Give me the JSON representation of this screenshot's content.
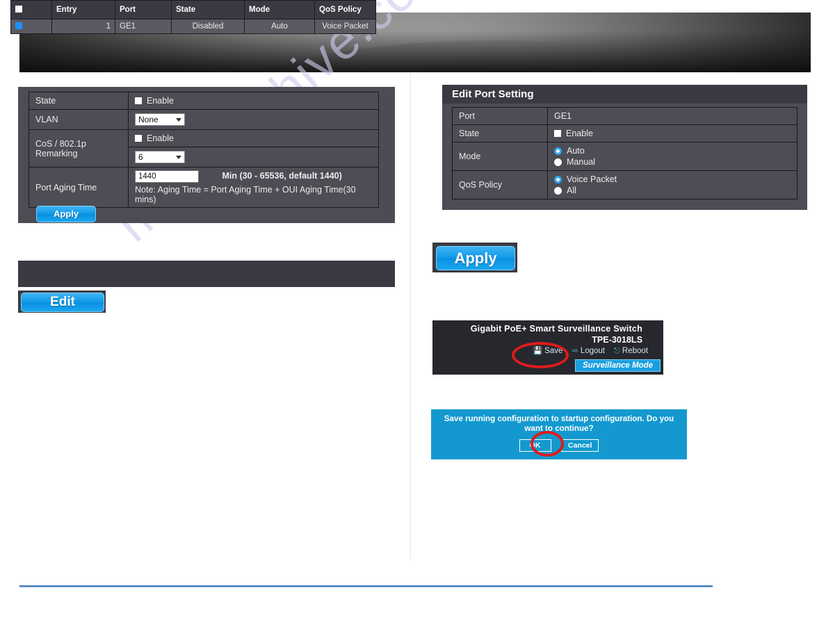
{
  "watermark": {
    "text": "manualshive.com"
  },
  "left_panel": {
    "rows": [
      {
        "label": "State",
        "control": "checkbox",
        "checkbox_label": "Enable",
        "checked": false
      },
      {
        "label": "VLAN",
        "control": "select",
        "value": "None"
      },
      {
        "label": "CoS / 802.1p Remarking",
        "label_line1": "CoS / 802.1p",
        "label_line2": "Remarking",
        "checkbox_label": "Enable",
        "checked": false,
        "select_value": "6"
      },
      {
        "label": "Port Aging Time",
        "input_value": "1440",
        "hint": "Min (30 - 65536, default 1440)",
        "note": "Note: Aging Time = Port Aging Time + OUI Aging Time(30 mins)"
      }
    ],
    "apply_label": "Apply"
  },
  "list_table": {
    "headers": [
      "",
      "Entry",
      "Port",
      "State",
      "Mode",
      "QoS Policy"
    ],
    "header_checkbox_checked": false,
    "rows": [
      {
        "checked": true,
        "entry": "1",
        "port": "GE1",
        "state": "Disabled",
        "mode": "Auto",
        "qos_policy": "Voice Packet"
      }
    ],
    "edit_label": "Edit"
  },
  "edit_port_setting": {
    "title": "Edit Port Setting",
    "port_label": "Port",
    "port_value": "GE1",
    "state_label": "State",
    "state_checkbox_label": "Enable",
    "state_checked": false,
    "mode_label": "Mode",
    "mode_options": [
      {
        "label": "Auto",
        "selected": true
      },
      {
        "label": "Manual",
        "selected": false
      }
    ],
    "qos_label": "QoS Policy",
    "qos_options": [
      {
        "label": "Voice Packet",
        "selected": true
      },
      {
        "label": "All",
        "selected": false
      }
    ],
    "apply_label": "Apply"
  },
  "device_header": {
    "product_name": "Gigabit PoE+ Smart Surveillance Switch",
    "model": "TPE-3018LS",
    "save_label": "Save",
    "logout_label": "Logout",
    "reboot_label": "Reboot",
    "mode_badge": "Surveillance Mode"
  },
  "confirm_dialog": {
    "message": "Save running configuration to startup configuration. Do you want to continue?",
    "ok_label": "OK",
    "cancel_label": "Cancel"
  },
  "colors": {
    "panel_bg": "#4c4c54",
    "header_bg": "#3a3a42",
    "accent_blue": "#1b9fe0",
    "dialog_blue": "#1399cf",
    "annotation_red": "#e01b1b",
    "rule_blue": "#5b8cc4"
  }
}
